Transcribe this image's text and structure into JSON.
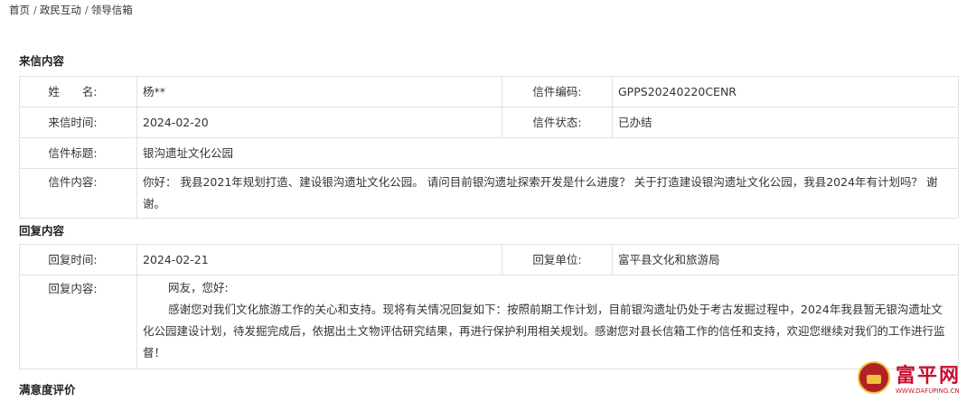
{
  "breadcrumb": {
    "home": "首页",
    "sep": "/",
    "interaction": "政民互动",
    "mailbox": "领导信箱"
  },
  "letter": {
    "section_title": "来信内容",
    "name_label": "姓　　名:",
    "name_value": "杨**",
    "code_label": "信件编码:",
    "code_value": "GPPS20240220CENR",
    "time_label": "来信时间:",
    "time_value": "2024-02-20",
    "status_label": "信件状态:",
    "status_value": "已办结",
    "title_label": "信件标题:",
    "title_value": "银沟遗址文化公园",
    "content_label": "信件内容:",
    "content_value": "你好： 我县2021年规划打造、建设银沟遗址文化公园。 请问目前银沟遗址探索开发是什么进度？ 关于打造建设银沟遗址文化公园，我县2024年有计划吗？ 谢谢。"
  },
  "reply": {
    "section_title": "回复内容",
    "time_label": "回复时间:",
    "time_value": "2024-02-21",
    "unit_label": "回复单位:",
    "unit_value": "富平县文化和旅游局",
    "content_label": "回复内容:",
    "greeting": "网友，您好:",
    "body": "感谢您对我们文化旅游工作的关心和支持。现将有关情况回复如下：按照前期工作计划，目前银沟遗址仍处于考古发掘过程中，2024年我县暂无银沟遗址文化公园建设计划，待发掘完成后，依据出土文物评估研究结果，再进行保护利用相关规划。感谢您对县长信箱工作的信任和支持，欢迎您继续对我们的工作进行监督！"
  },
  "satisfaction": {
    "section_title": "满意度评价"
  },
  "watermark": {
    "brand": "富平网",
    "url": "WWW.DAFUPING.CN"
  }
}
